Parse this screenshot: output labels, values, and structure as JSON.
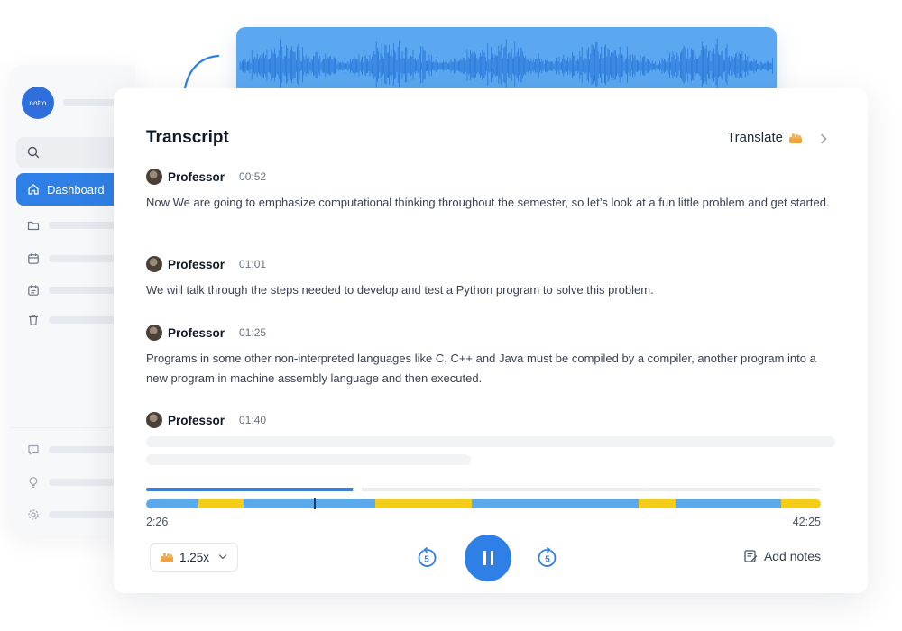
{
  "app": {
    "logo_text": "notto"
  },
  "sidebar": {
    "active_item": "Dashboard"
  },
  "transcript": {
    "title": "Transcript",
    "translate_label": "Translate",
    "entries": [
      {
        "speaker": "Professor",
        "time": "00:52",
        "text": "Now We are going to emphasize computational thinking throughout the semester, so let’s look at a fun little problem and get started."
      },
      {
        "speaker": "Professor",
        "time": "01:01",
        "text": "We will talk through the steps needed to develop and test a Python program to solve this problem."
      },
      {
        "speaker": "Professor",
        "time": "01:25",
        "text": "Programs in some other non-interpreted languages like C, C++ and Java must be compiled by a compiler, another program into a new program in machine assembly language and then executed."
      },
      {
        "speaker": "Professor",
        "time": "01:40",
        "text": ""
      }
    ]
  },
  "player": {
    "current_time": "2:26",
    "total_time": "42:25",
    "progress_fraction": 0.31,
    "speed": "1.25x",
    "skip_back_label": "5",
    "skip_forward_label": "5",
    "add_notes_label": "Add notes",
    "segment_colors": {
      "blue": "#5aa9ec",
      "yellow": "#f3cd1a"
    },
    "segments": [
      {
        "color": "blue",
        "fraction": 0.078
      },
      {
        "color": "yellow",
        "fraction": 0.066
      },
      {
        "color": "blue",
        "fraction": 0.195
      },
      {
        "color": "yellow",
        "fraction": 0.143
      },
      {
        "color": "blue",
        "fraction": 0.248
      },
      {
        "color": "yellow",
        "fraction": 0.055
      },
      {
        "color": "blue",
        "fraction": 0.156
      },
      {
        "color": "yellow",
        "fraction": 0.059
      }
    ]
  },
  "colors": {
    "accent": "#2f80e6",
    "waveform_bg": "#5ba8f0",
    "waveform_line": "#1f6fd6"
  }
}
